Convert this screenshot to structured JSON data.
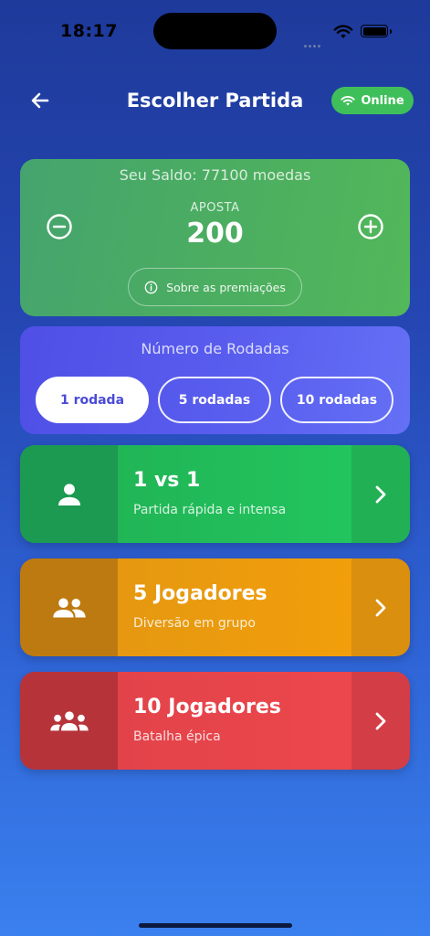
{
  "status_bar": {
    "time": "18:17"
  },
  "header": {
    "title": "Escolher Partida",
    "online_label": "Online"
  },
  "bet": {
    "balance_text": "Seu Saldo: 77100 moedas",
    "label": "APOSTA",
    "value": "200",
    "prize_info_label": "Sobre as premiações"
  },
  "rounds": {
    "title": "Número de Rodadas",
    "options": [
      "1 rodada",
      "5 rodadas",
      "10 rodadas"
    ],
    "selected": "1 rodada"
  },
  "modes": [
    {
      "name": "1 vs 1",
      "desc": "Partida rápida e intensa",
      "icon": "person-icon",
      "color": "#22c55e"
    },
    {
      "name": "5 Jogadores",
      "desc": "Diversão em grupo",
      "icon": "group-icon",
      "color": "#f29e0b"
    },
    {
      "name": "10 Jogadores",
      "desc": "Batalha épica",
      "icon": "groups-icon",
      "color": "#ec474c"
    }
  ],
  "colors": {
    "online_badge": "#3fbf5a",
    "bet_card": "#4cae60",
    "rounds_card": "#5a5fef",
    "selected_pill_text": "#4a4ad8"
  }
}
